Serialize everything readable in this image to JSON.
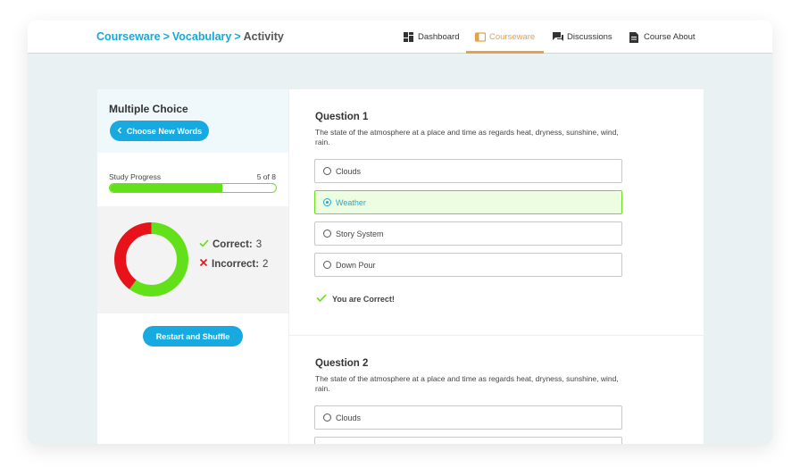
{
  "breadcrumb": {
    "items": [
      "Courseware",
      "Vocabulary"
    ],
    "separator": ">",
    "current": "Activity"
  },
  "nav": [
    {
      "label": "Dashboard",
      "icon": "dashboard-icon",
      "active": false
    },
    {
      "label": "Courseware",
      "icon": "book-icon",
      "active": true
    },
    {
      "label": "Discussions",
      "icon": "chat-icon",
      "active": false
    },
    {
      "label": "Course About",
      "icon": "document-icon",
      "active": false
    }
  ],
  "sidebar": {
    "title": "Multiple Choice",
    "choose_button": "Choose New Words",
    "progress": {
      "label": "Study Progress",
      "count": "5 of 8",
      "fraction": 0.675
    },
    "stats": {
      "correct_label": "Correct:",
      "correct_value": 3,
      "incorrect_label": "Incorrect:",
      "incorrect_value": 2
    },
    "restart_button": "Restart and Shuffle"
  },
  "questions": [
    {
      "title": "Question 1",
      "text": "The state of the atmosphere at a place and time as regards heat, dryness, sunshine, wind, rain.",
      "options": [
        "Clouds",
        "Weather",
        "Story System",
        "Down Pour"
      ],
      "selected_index": 1,
      "feedback": "You are Correct!"
    },
    {
      "title": "Question 2",
      "text": "The state of the atmosphere at a place and time as regards heat, dryness, sunshine, wind, rain.",
      "options": [
        "Clouds"
      ]
    }
  ],
  "colors": {
    "accent_blue": "#17aae0",
    "active_orange": "#e3a24a",
    "correct_green": "#62e01a",
    "incorrect_red": "#e8131a"
  }
}
